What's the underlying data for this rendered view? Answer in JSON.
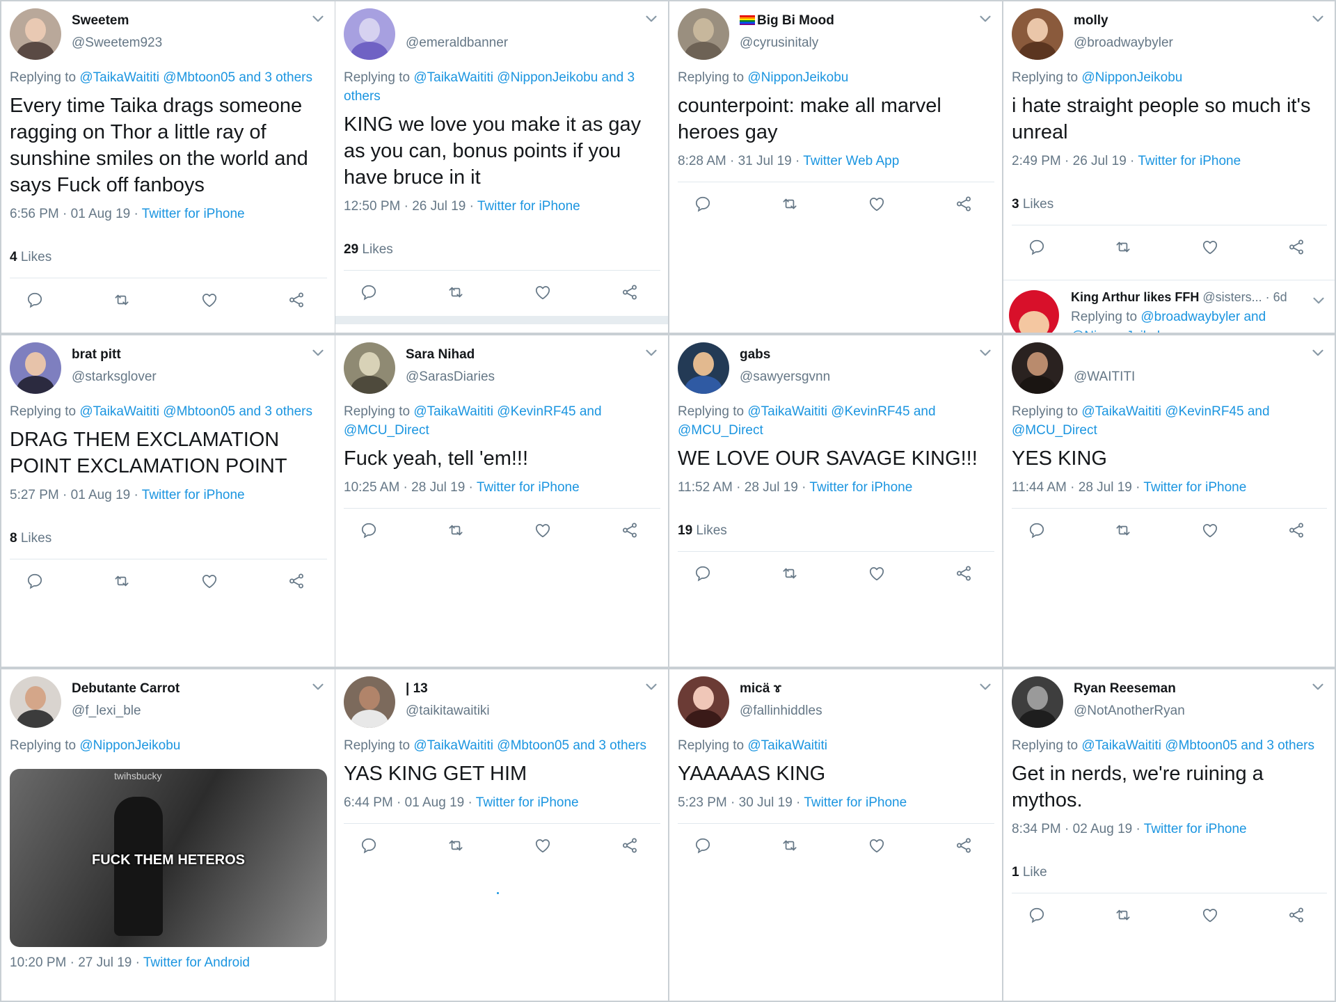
{
  "colors": {
    "link": "#1b95e0",
    "muted": "#657786",
    "text": "#14171a",
    "divider": "#e1e8ed"
  },
  "icons": {
    "reply": "reply-icon",
    "retweet": "retweet-icon",
    "like": "like-icon",
    "share": "share-icon",
    "caret": "chevron-down-icon"
  },
  "tweets": [
    {
      "name": "Sweetem",
      "handle": "@Sweetem923",
      "replying_prefix": "Replying to",
      "replying_to": "@TaikaWaititi @Mbtoon05 and 3 others",
      "text": "Every time Taika drags someone ragging on Thor a little ray of sunshine smiles on the world and says Fuck off fanboys",
      "time": "6:56 PM · 01 Aug 19 ·",
      "source": "Twitter for iPhone",
      "likes_count": "4",
      "likes_label": "Likes",
      "avatar": {
        "bg": "#b9a89a",
        "face": "#e9c9b3",
        "body": "#5a4a44"
      }
    },
    {
      "name": "",
      "handle": "@emeraldbanner",
      "replying_prefix": "Replying to",
      "replying_to": "@TaikaWaititi @NipponJeikobu and 3 others",
      "text": "KING we love you make it as gay as you can, bonus points if you have bruce in it",
      "time": "12:50 PM · 26 Jul 19 ·",
      "source": "Twitter for iPhone",
      "likes_count": "29",
      "likes_label": "Likes",
      "avatar": {
        "bg": "#a7a0e0",
        "face": "#d6d2f0",
        "body": "#6f62c4"
      }
    },
    {
      "name": "Big Bi Mood",
      "handle": "@cyrusinitaly",
      "replying_prefix": "Replying to",
      "replying_to": "@NipponJeikobu",
      "text": "counterpoint: make all marvel heroes gay",
      "time": "8:28 AM · 31 Jul 19 ·",
      "source": "Twitter Web App",
      "avatar": {
        "bg": "#9a8f7f",
        "face": "#c7b79c",
        "body": "#6d6255"
      }
    },
    {
      "name": "molly",
      "handle": "@broadwaybyler",
      "replying_prefix": "Replying to",
      "replying_to": "@NipponJeikobu",
      "text": "i hate straight people so much it's unreal",
      "time": "2:49 PM · 26 Jul 19 ·",
      "source": "Twitter for iPhone",
      "likes_count": "3",
      "likes_label": "Likes",
      "avatar": {
        "bg": "#8a5a3c",
        "face": "#eac6a9",
        "body": "#5b3520"
      },
      "sub": {
        "name": "King Arthur likes FFH",
        "handle": "@sisters...",
        "age": "· 6d",
        "replying_prefix": "Replying to",
        "replying_to": "@broadwaybyler and",
        "line2": "@NipponJeikobu"
      }
    },
    {
      "name": "brat pitt",
      "handle": "@starksglover",
      "replying_prefix": "Replying to",
      "replying_to": "@TaikaWaititi @Mbtoon05 and 3 others",
      "text": "DRAG THEM EXCLAMATION POINT EXCLAMATION POINT",
      "time": "5:27 PM · 01 Aug 19 ·",
      "source": "Twitter for iPhone",
      "likes_count": "8",
      "likes_label": "Likes",
      "avatar": {
        "bg": "#7e7fbf",
        "face": "#e7c3aa",
        "body": "#2b2a3f"
      }
    },
    {
      "name": "Sara Nihad",
      "handle": "@SarasDiaries",
      "replying_prefix": "Replying to",
      "replying_to": "@TaikaWaititi @KevinRF45 and @MCU_Direct",
      "text": "Fuck yeah, tell 'em!!!",
      "time": "10:25 AM · 28 Jul 19 ·",
      "source": "Twitter for iPhone",
      "avatar": {
        "bg": "#8f8a73",
        "face": "#d8d2b7",
        "body": "#4e4a3c"
      }
    },
    {
      "name": "gabs",
      "handle": "@sawyersgvnn",
      "replying_prefix": "Replying to",
      "replying_to": "@TaikaWaititi @KevinRF45 and @MCU_Direct",
      "text": "WE LOVE OUR SAVAGE KING!!!",
      "time": "11:52 AM · 28 Jul 19 ·",
      "source": "Twitter for iPhone",
      "likes_count": "19",
      "likes_label": "Likes",
      "avatar": {
        "bg": "#233a55",
        "face": "#e2b98f",
        "body": "#2f5aa3"
      }
    },
    {
      "name": "",
      "handle": "@WAITITI",
      "replying_prefix": "Replying to",
      "replying_to": "@TaikaWaititi @KevinRF45 and @MCU_Direct",
      "text": "YES KING",
      "time": "11:44 AM · 28 Jul 19 ·",
      "source": "Twitter for iPhone",
      "avatar": {
        "bg": "#2a2220",
        "face": "#b98b6d",
        "body": "#1a1512"
      }
    },
    {
      "name": "Debutante Carrot",
      "handle": "@f_lexi_ble",
      "replying_prefix": "Replying to",
      "replying_to": "@NipponJeikobu",
      "media_caption": "FUCK THEM HETEROS",
      "media_watermark": "twihsbucky",
      "time": "10:20 PM · 27 Jul 19 ·",
      "source": "Twitter for Android",
      "avatar": {
        "bg": "#d9d4cf",
        "face": "#d4a689",
        "body": "#3c3c3c"
      }
    },
    {
      "name": "| 13",
      "handle": "@taikitawaitiki",
      "replying_prefix": "Replying to",
      "replying_to": "@TaikaWaititi @Mbtoon05 and 3 others",
      "text": "YAS KING GET HIM",
      "time": "6:44 PM · 01 Aug 19 ·",
      "source": "Twitter for iPhone",
      "avatar": {
        "bg": "#7c6a5c",
        "face": "#b1846a",
        "body": "#e8e8e8"
      }
    },
    {
      "name": "micä ɤ",
      "handle": "@fallinhiddles",
      "replying_prefix": "Replying to",
      "replying_to": "@TaikaWaititi",
      "text": "YAAAAAS KING",
      "time": "5:23 PM · 30 Jul 19 ·",
      "source": "Twitter for iPhone",
      "avatar": {
        "bg": "#6b3b35",
        "face": "#f0c7b8",
        "body": "#3a1a18"
      }
    },
    {
      "name": "Ryan Reeseman",
      "handle": "@NotAnotherRyan",
      "replying_prefix": "Replying to",
      "replying_to": "@TaikaWaititi @Mbtoon05 and 3 others",
      "text": "Get in nerds, we're ruining a mythos.",
      "time": "8:34 PM · 02 Aug 19 ·",
      "source": "Twitter for iPhone",
      "likes_count": "1",
      "likes_label": "Like",
      "avatar": {
        "bg": "#3e3e3e",
        "face": "#9a9a9a",
        "body": "#1e1e1e"
      }
    }
  ]
}
